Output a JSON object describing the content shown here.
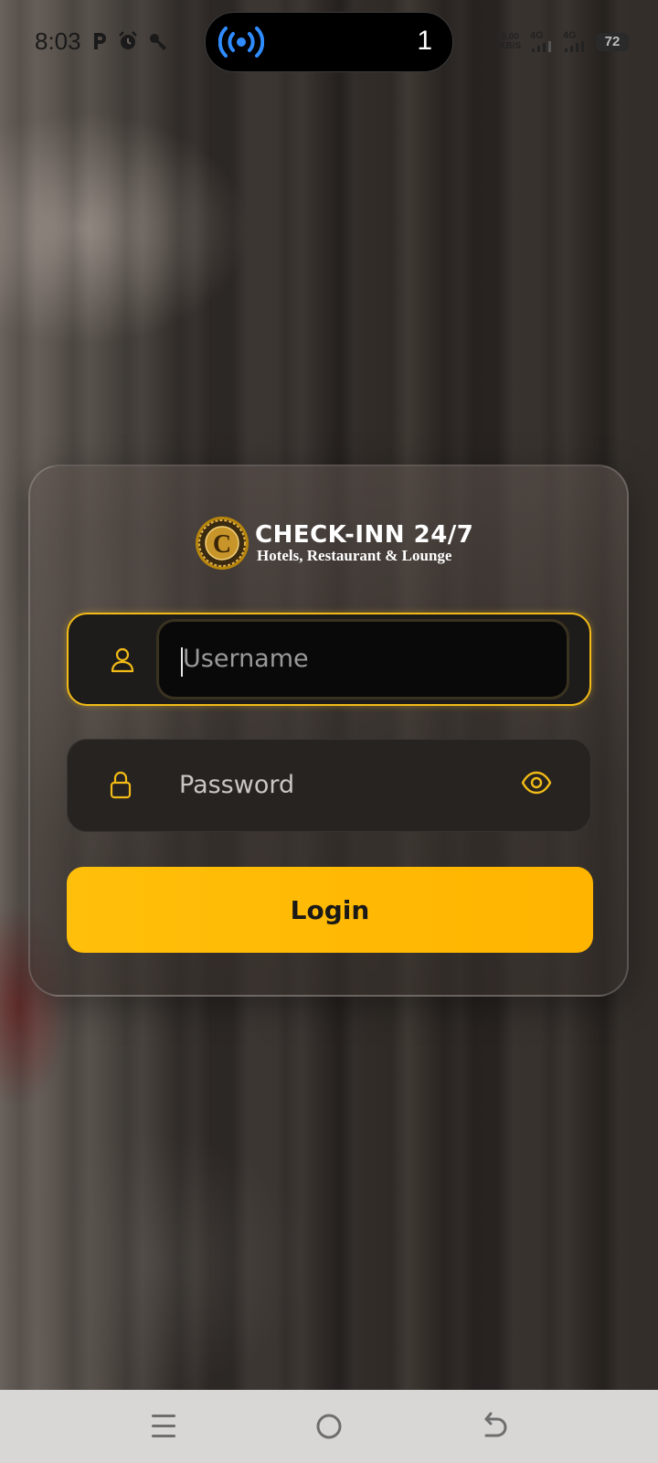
{
  "status_bar": {
    "time": "8:03",
    "island_count": "1",
    "net_speed_value": "0.00",
    "net_speed_unit": "KB/S",
    "sim1_label": "4G",
    "sim2_label": "4G",
    "battery_level": "72",
    "icons": [
      "parking-icon",
      "alarm-icon",
      "key-icon",
      "broadcast-icon",
      "signal-icon",
      "battery-icon"
    ]
  },
  "brand": {
    "title": "CHECK-INN 24/7",
    "subtitle": "Hotels, Restaurant & Lounge",
    "seal_letter": "C"
  },
  "form": {
    "username_placeholder": "Username",
    "password_placeholder": "Password",
    "login_label": "Login",
    "accent_color": "#f2bb16"
  },
  "nav": {
    "icons": [
      "menu-icon",
      "home-icon",
      "back-icon"
    ]
  }
}
